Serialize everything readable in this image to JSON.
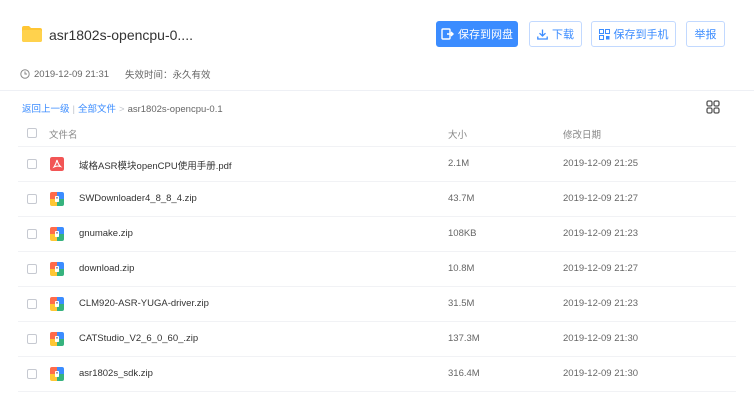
{
  "share": {
    "title": "asr1802s-opencpu-0....",
    "created": "2019-12-09 21:31",
    "expiry_label": "失效时间：永久有效"
  },
  "actions": {
    "save_to_disk": "保存到网盘",
    "download": "下载",
    "save_to_phone": "保存到手机",
    "report": "举报"
  },
  "breadcrumb": {
    "back": "返回上一级",
    "separator": "|",
    "all_files": "全部文件",
    "arrow": ">",
    "current": "asr1802s-opencpu-0.1"
  },
  "columns": {
    "name": "文件名",
    "size": "大小",
    "modified": "修改日期"
  },
  "files": [
    {
      "name": "域格ASR模块openCPU使用手册.pdf",
      "size": "2.1M",
      "modified": "2019-12-09 21:25",
      "type": "pdf"
    },
    {
      "name": "SWDownloader4_8_8_4.zip",
      "size": "43.7M",
      "modified": "2019-12-09 21:27",
      "type": "zip"
    },
    {
      "name": "gnumake.zip",
      "size": "108KB",
      "modified": "2019-12-09 21:23",
      "type": "zip"
    },
    {
      "name": "download.zip",
      "size": "10.8M",
      "modified": "2019-12-09 21:27",
      "type": "zip"
    },
    {
      "name": "CLM920-ASR-YUGA-driver.zip",
      "size": "31.5M",
      "modified": "2019-12-09 21:23",
      "type": "zip"
    },
    {
      "name": "CATStudio_V2_6_0_60_.zip",
      "size": "137.3M",
      "modified": "2019-12-09 21:30",
      "type": "zip"
    },
    {
      "name": "asr1802s_sdk.zip",
      "size": "316.4M",
      "modified": "2019-12-09 21:30",
      "type": "zip"
    }
  ],
  "colors": {
    "accent": "#3b8cff",
    "folder": "#ffc634",
    "pdf": "#f25555"
  },
  "icons": {
    "folder": "folder-icon",
    "save": "save-to-disk-icon",
    "download": "download-icon",
    "phone": "qr-phone-icon",
    "clock": "clock-icon",
    "grid": "grid-view-icon",
    "pdf": "pdf-file-icon",
    "zip": "zip-file-icon"
  }
}
